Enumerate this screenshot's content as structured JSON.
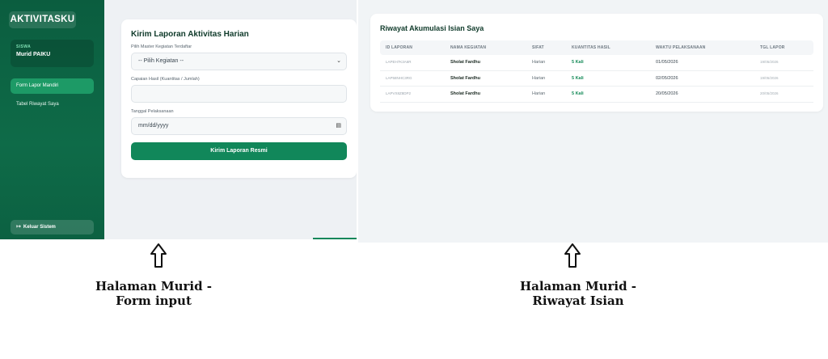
{
  "left": {
    "brand": "AKTIVITASKU",
    "user": {
      "role": "SISWA",
      "name": "Murid PAIKU"
    },
    "nav": [
      {
        "label": "Form Lapor Mandiri",
        "active": true
      },
      {
        "label": "Tabel Riwayat Saya",
        "active": false
      }
    ],
    "logout": {
      "icon": "logout-icon",
      "label": "Keluar Sistem"
    },
    "form": {
      "title": "Kirim Laporan Aktivitas Harian",
      "master_label": "Pilih Master Kegiatan Terdaftar",
      "master_value": "-- Pilih Kegiatan --",
      "capaian_label": "Capaian Hasil (Kuantitas / Jumlah)",
      "capaian_value": "",
      "tanggal_label": "Tanggal Pelaksanaan",
      "tanggal_value": "mm/dd/yyyy",
      "submit_label": "Kirim Laporan Resmi"
    }
  },
  "right": {
    "title": "Riwayat Akumulasi Isian Saya",
    "columns": [
      "ID LAPORAN",
      "NAMA KEGIATAN",
      "SIFAT",
      "KUANTITAS HASIL",
      "WAKTU PELAKSANAAN",
      "TGL LAPOR"
    ],
    "rows": [
      {
        "id": "LAPEH7K3A6R",
        "nama": "Sholat Fardhu",
        "sifat": "Harian",
        "kuantitas": "5 Kali",
        "waktu": "01/05/2026",
        "tgl": "19/05/2026"
      },
      {
        "id": "LAP58NHC3RG",
        "nama": "Sholat Fardhu",
        "sifat": "Harian",
        "kuantitas": "5 Kali",
        "waktu": "02/05/2026",
        "tgl": "19/05/2026"
      },
      {
        "id": "LAPVX8Z8DP2",
        "nama": "Sholat Fardhu",
        "sifat": "Harian",
        "kuantitas": "5 Kali",
        "waktu": "20/05/2026",
        "tgl": "20/05/2026"
      }
    ]
  },
  "captions": {
    "left": [
      "Halaman Murid -",
      "Form input"
    ],
    "right": [
      "Halaman Murid -",
      "Riwayat Isian"
    ]
  },
  "colors": {
    "primary": "#11875a",
    "sidebar": "#0b5d3f",
    "accent_text": "#148a57"
  }
}
